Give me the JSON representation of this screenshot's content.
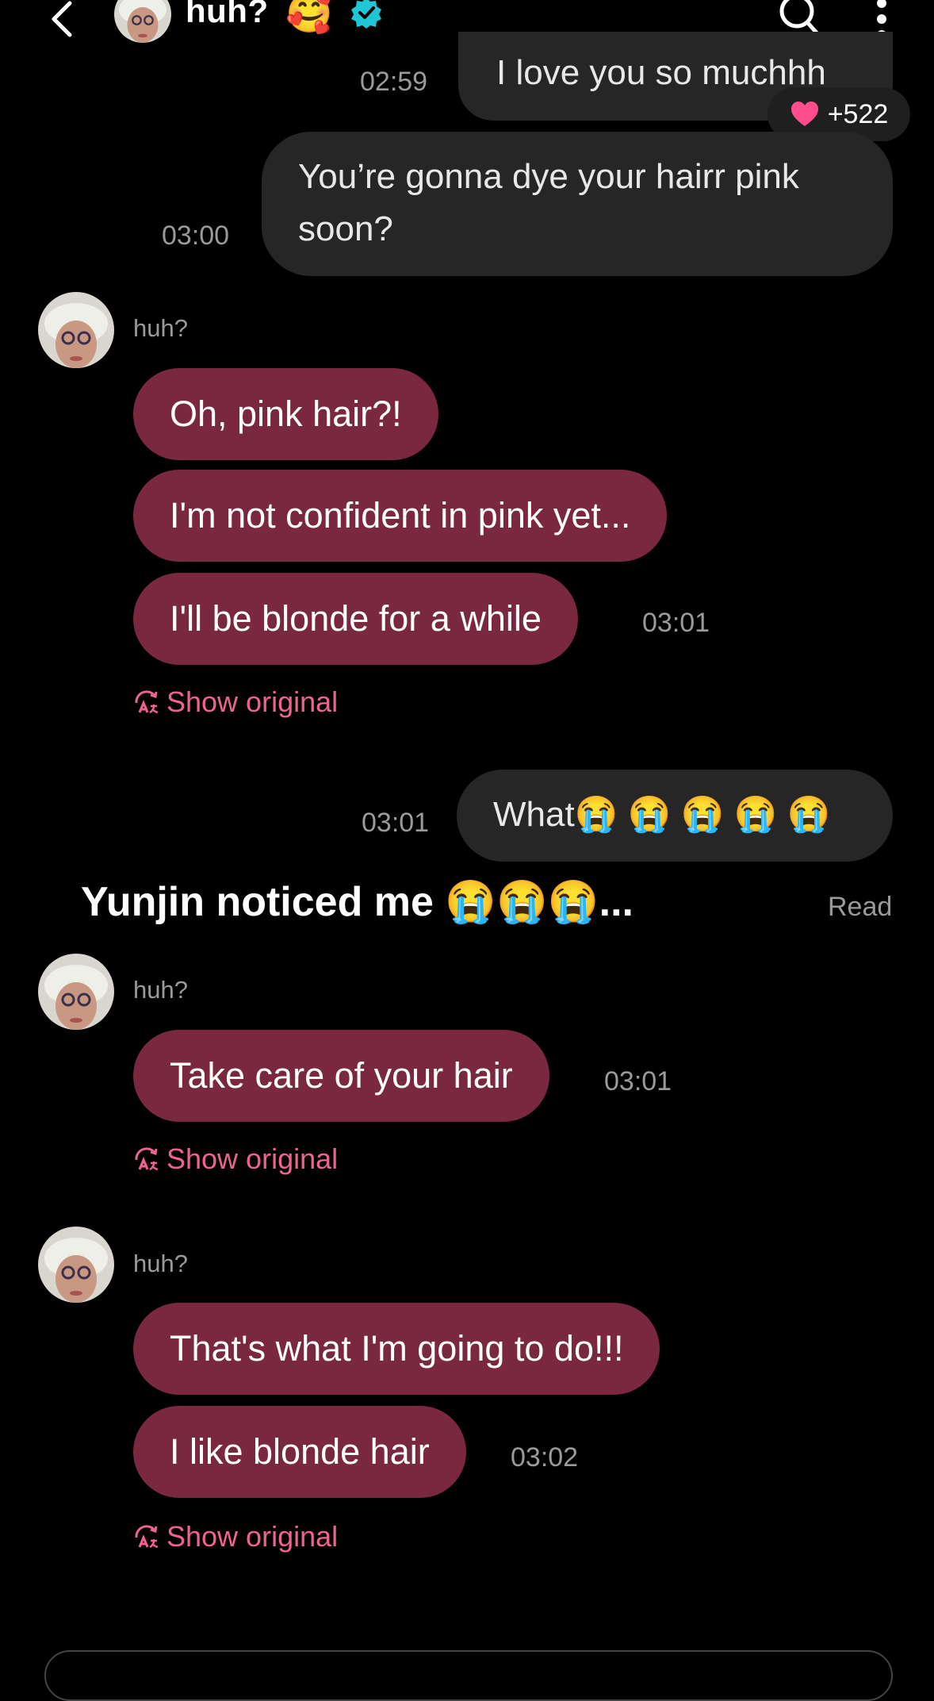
{
  "header": {
    "name": "huh?",
    "emoji": "🥰"
  },
  "messages": {
    "m1": {
      "text": "I love you so muchhh",
      "time": "02:59",
      "reaction_count": "+522"
    },
    "m2": {
      "line1": "You’re gonna dye your hairr pink",
      "line2": "soon?",
      "time": "03:00"
    },
    "g1": {
      "sender": "huh?",
      "b1": "Oh, pink hair?!",
      "b2": "I'm not confident in pink yet...",
      "b3": "I'll be blonde for a while",
      "time": "03:01",
      "show_original": "Show original"
    },
    "m3": {
      "text": "What😭 😭 😭 😭 😭",
      "time": "03:01"
    },
    "notice": "Yunjin noticed me 😭😭😭...",
    "read": "Read",
    "g2": {
      "sender": "huh?",
      "b1": "Take care of your hair",
      "time": "03:01",
      "show_original": "Show original"
    },
    "g3": {
      "sender": "huh?",
      "b1": "That's what I'm going to do!!!",
      "b2": "I like blonde hair",
      "time": "03:02",
      "show_original": "Show original"
    }
  },
  "colors": {
    "incoming_bubble": "#7a2740",
    "outgoing_bubble": "#262626",
    "accent_pink": "#f06292",
    "verified": "#1fc6d6"
  },
  "icons": [
    "back-icon",
    "verified-icon",
    "search-icon",
    "more-icon",
    "heart-icon",
    "translate-icon"
  ]
}
